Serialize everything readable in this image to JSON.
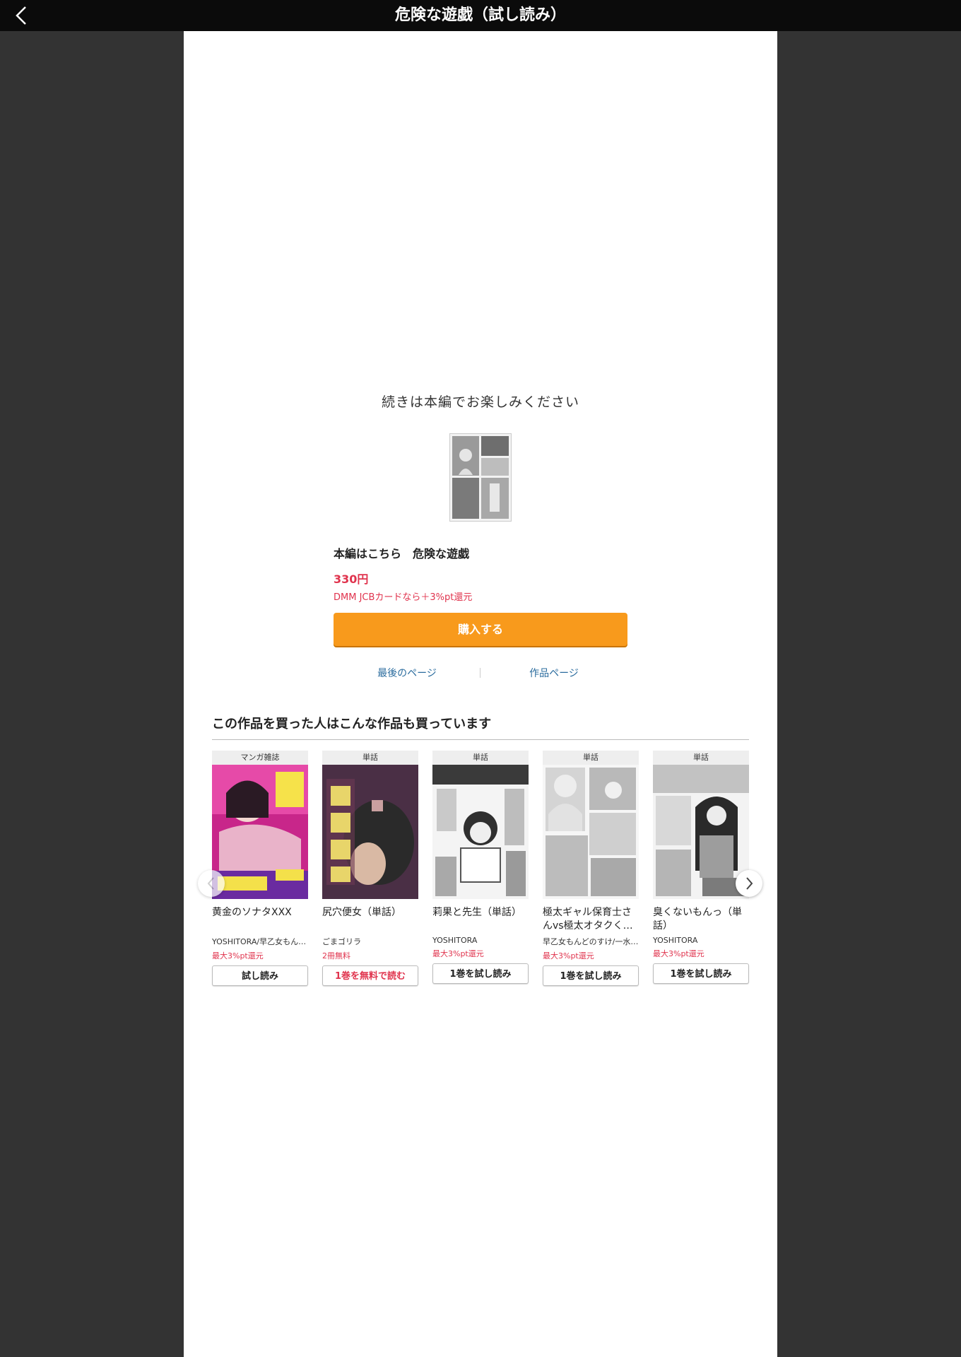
{
  "viewer": {
    "title": "危険な遊戯（試し読み）",
    "back_icon": "chevron-left-icon"
  },
  "endcard": {
    "heading": "続きは本編でお楽しみください",
    "product_name": "本編はこちら　危険な遊戯",
    "price": "330円",
    "campaign": "DMM JCBカードなら＋3%pt還元",
    "buy_label": "購入する",
    "last_page_link": "最後のページ",
    "product_page_link": "作品ページ"
  },
  "colors": {
    "buy_button": "#f89a1c",
    "price": "#e0334d",
    "link": "#2b6c9e",
    "viewer_bar": "#0b0b0b",
    "backdrop": "#333333"
  },
  "recommend": {
    "title": "この作品を買った人はこんな作品も買っています",
    "prev_icon": "chevron-left-icon",
    "next_icon": "chevron-right-icon",
    "items": [
      {
        "category": "マンガ雑誌",
        "title": "黄金のソナタXXX",
        "author": "YOSHITORA/早乙女もん…",
        "campaign": "最大3%pt還元",
        "button": "試し読み"
      },
      {
        "category": "単話",
        "title": "尻穴便女（単話）",
        "author": "ごまゴリラ",
        "campaign": "2冊無料",
        "button": "1巻を無料で読む"
      },
      {
        "category": "単話",
        "title": "莉果と先生（単話）",
        "author": "YOSHITORA",
        "campaign": "最大3%pt還元",
        "button": "1巻を試し読み"
      },
      {
        "category": "単話",
        "title": "極太ギャル保育士さんvs極太オタクく…",
        "author": "早乙女もんどのすけ/一水…",
        "campaign": "最大3%pt還元",
        "button": "1巻を試し読み"
      },
      {
        "category": "単話",
        "title": "臭くないもんっ（単話）",
        "author": "YOSHITORA",
        "campaign": "最大3%pt還元",
        "button": "1巻を試し読み"
      }
    ]
  }
}
